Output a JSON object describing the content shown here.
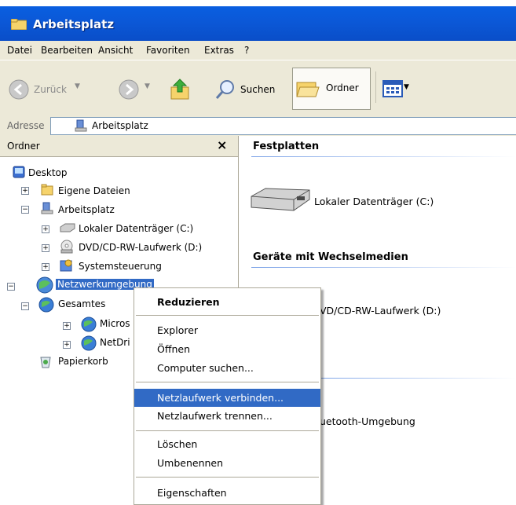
{
  "window": {
    "title": "Arbeitsplatz"
  },
  "menubar": [
    "Datei",
    "Bearbeiten",
    "Ansicht",
    "Favoriten",
    "Extras",
    "?"
  ],
  "toolbar": {
    "back_label": "Zurück",
    "search_label": "Suchen",
    "folders_label": "Ordner"
  },
  "address": {
    "label": "Adresse",
    "value": "Arbeitsplatz"
  },
  "folder_pane": {
    "header": "Ordner",
    "close_glyph": "×",
    "items": [
      {
        "label": "Desktop",
        "expander": ""
      },
      {
        "label": "Eigene Dateien",
        "expander": "+"
      },
      {
        "label": "Arbeitsplatz",
        "expander": "−"
      },
      {
        "label": "Lokaler Datenträger (C:)",
        "expander": "+"
      },
      {
        "label": "DVD/CD-RW-Laufwerk (D:)",
        "expander": "+"
      },
      {
        "label": "Systemsteuerung",
        "expander": "+"
      },
      {
        "label": "Netzwerkumgebung",
        "expander": "−"
      },
      {
        "label": "Gesamtes",
        "expander": "−"
      },
      {
        "label": "Micros",
        "expander": "+"
      },
      {
        "label": "NetDri",
        "expander": "+"
      },
      {
        "label": "Papierkorb",
        "expander": ""
      }
    ]
  },
  "content": {
    "groups": [
      {
        "header": "Festplatten",
        "items": [
          "Lokaler Datenträger (C:)"
        ]
      },
      {
        "header": "Geräte mit Wechselmedien",
        "items": [
          "VD/CD-RW-Laufwerk (D:)"
        ]
      }
    ],
    "other_item": "uetooth-Umgebung"
  },
  "context_menu": {
    "items": [
      {
        "label": "Reduzieren",
        "bold": true
      },
      {
        "label": "Explorer"
      },
      {
        "label": "Öffnen"
      },
      {
        "label": "Computer suchen..."
      },
      {
        "label": "Netzlaufwerk verbinden...",
        "highlighted": true
      },
      {
        "label": "Netzlaufwerk trennen..."
      },
      {
        "label": "Löschen"
      },
      {
        "label": "Umbenennen"
      },
      {
        "label": "Eigenschaften"
      }
    ]
  },
  "icons": {
    "folder": "folder-icon",
    "computer": "computer-icon",
    "desktop": "desktop-icon",
    "network": "network-icon",
    "recycle": "recycle-bin-icon",
    "disk": "hard-disk-icon",
    "cd": "cd-drive-icon",
    "control": "control-panel-icon",
    "globe": "globe-icon"
  },
  "colors": {
    "title_blue": "#0a5fe0",
    "selection": "#316ac5",
    "chrome": "#ece9d8"
  }
}
